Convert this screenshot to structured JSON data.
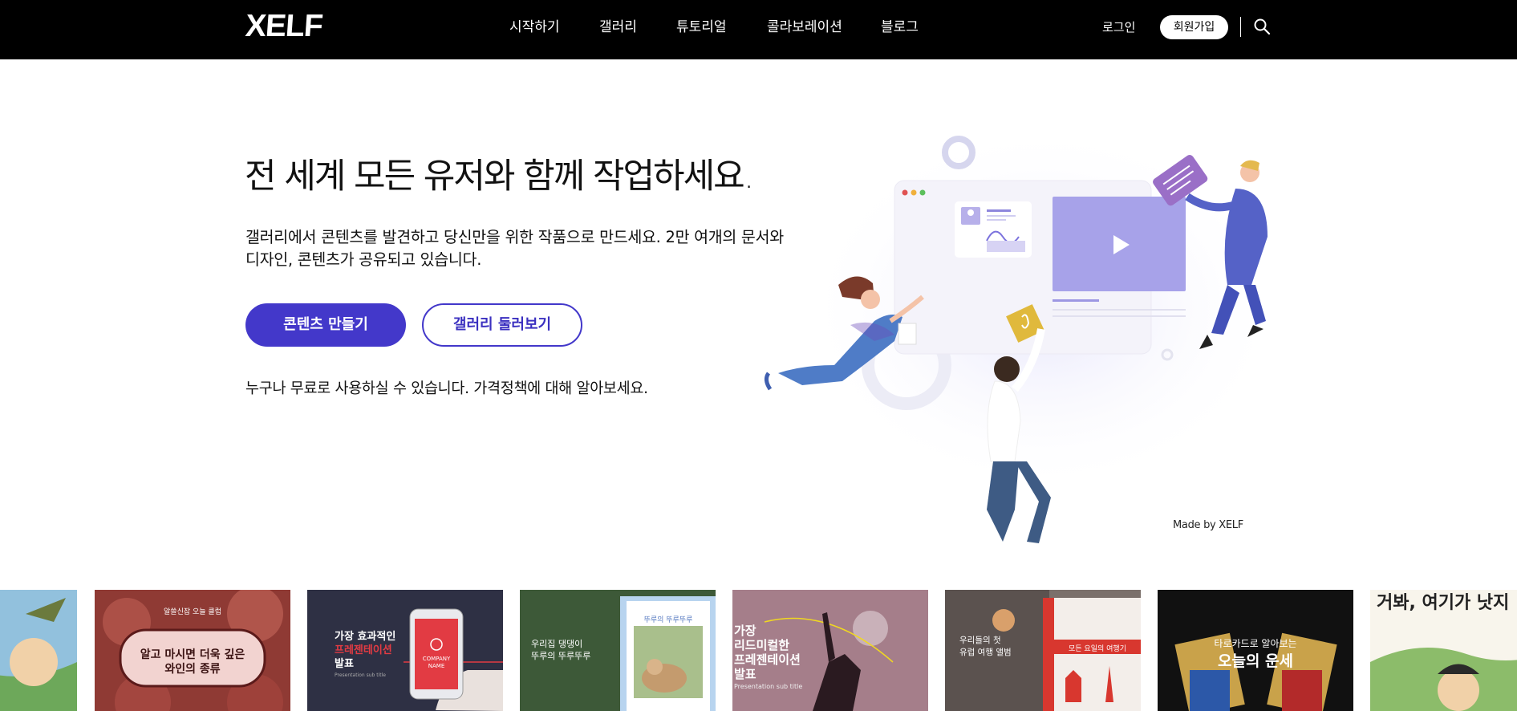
{
  "nav": {
    "logo": "XELF",
    "items": [
      "시작하기",
      "갤러리",
      "튜토리얼",
      "콜라보레이션",
      "블로그"
    ],
    "login": "로그인",
    "signup": "회원가입"
  },
  "hero": {
    "title": "전 세계 모든 유저와 함께 작업하세요.",
    "desc_line1": "갤러리에서 콘텐츠를 발견하고 당신만을 위한 작품으로 만드세요. 2만 여개의 문서와",
    "desc_line2": "디자인, 콘텐츠가 공유되고 있습니다.",
    "primary_button": "콘텐츠 만들기",
    "secondary_button": "갤러리 둘러보기",
    "note": "누구나 무료로 사용하실 수 있습니다. 가격정책에 대해 알아보세요.",
    "made_by": "Made by XELF"
  },
  "colors": {
    "accent": "#4338ca",
    "nav_bg": "#000000"
  },
  "icons": {
    "search": "search-icon",
    "play": "play-icon"
  },
  "gallery": [
    {
      "line1": "",
      "line2": ""
    },
    {
      "top": "알쓸신잡 오늘 클럽",
      "line1": "알고 마시면 더욱 깊은",
      "line2": "와인의 종류"
    },
    {
      "line1": "가장 효과적인",
      "line2": "프레젠테이션",
      "line3": "발표",
      "sub": "Presentation sub title",
      "phone": "COMPANY NAME"
    },
    {
      "line1": "우리집 댕댕이",
      "line2": "뚜루의 뚜루뚜루",
      "card": "뚜루의 뚜루뚜루"
    },
    {
      "line1": "가장",
      "line2": "리드미컬한",
      "line3": "프레젠테이션",
      "line4": "발표",
      "sub": "Presentation sub title"
    },
    {
      "line1": "우리들의 첫",
      "line2": "유럽 여행 앨범",
      "card": "모든 요일의 여행기"
    },
    {
      "line1": "타로카드로 알아보는",
      "line2": "오늘의 운세"
    },
    {
      "line1": "거봐, 여기가 낫지"
    }
  ]
}
